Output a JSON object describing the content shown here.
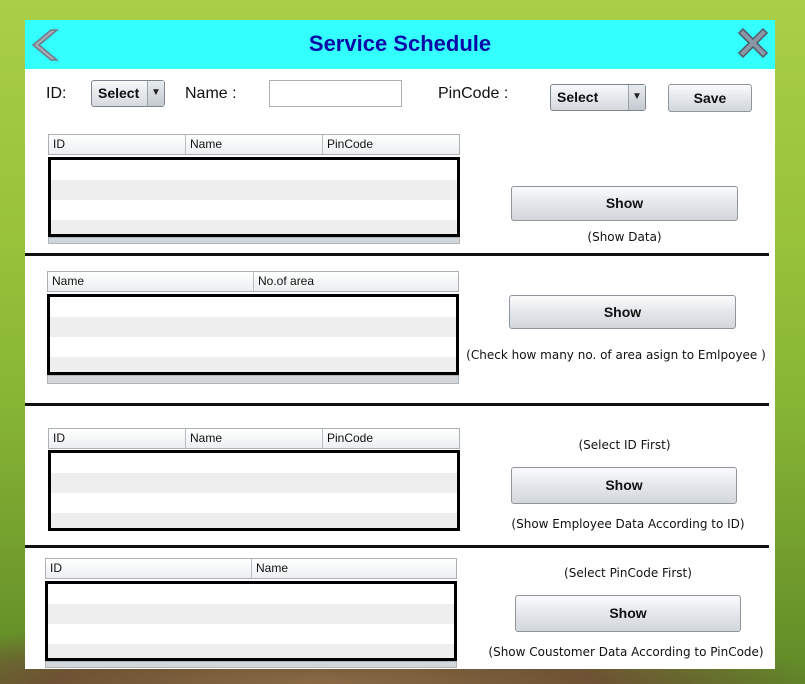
{
  "window": {
    "title": "Service Schedule",
    "icons": {
      "back": "back-arrow-icon",
      "close": "close-x-icon"
    },
    "colors": {
      "titlebar": "#33ffff",
      "title_text": "#0a0aa8"
    }
  },
  "form": {
    "id_label": "ID:",
    "id_select_value": "Select",
    "name_label": "Name :",
    "name_value": "",
    "pincode_label": "PinCode :",
    "pincode_select_value": "Select",
    "save_label": "Save"
  },
  "sections": [
    {
      "columns": [
        "ID",
        "Name",
        "PinCode"
      ],
      "button_label": "Show",
      "note_above": "",
      "note_below": "(Show Data)"
    },
    {
      "columns": [
        "Name",
        "No.of area"
      ],
      "button_label": "Show",
      "note_above": "",
      "note_below": "(Check how many no. of area asign to Emlpoyee )"
    },
    {
      "columns": [
        "ID",
        "Name",
        "PinCode"
      ],
      "button_label": "Show",
      "note_above": "(Select ID First)",
      "note_below": "(Show Employee Data According to ID)"
    },
    {
      "columns": [
        "ID",
        "Name"
      ],
      "button_label": "Show",
      "note_above": "(Select PinCode First)",
      "note_below": "(Show Coustomer Data According to PinCode)"
    }
  ]
}
